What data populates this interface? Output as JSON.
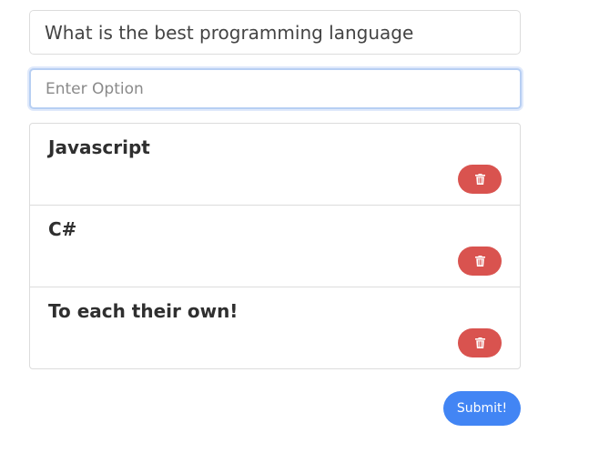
{
  "question": {
    "value": "What is the best programming language"
  },
  "option_input": {
    "placeholder": "Enter Option",
    "value": ""
  },
  "options": [
    {
      "label": "Javascript"
    },
    {
      "label": "C#"
    },
    {
      "label": "To each their own!"
    }
  ],
  "delete_icon": "trash-icon",
  "submit": {
    "label": "Submit!"
  },
  "colors": {
    "delete_button": "#d9534f",
    "submit_button": "#4285f4",
    "focus_border": "#b7cff3"
  }
}
